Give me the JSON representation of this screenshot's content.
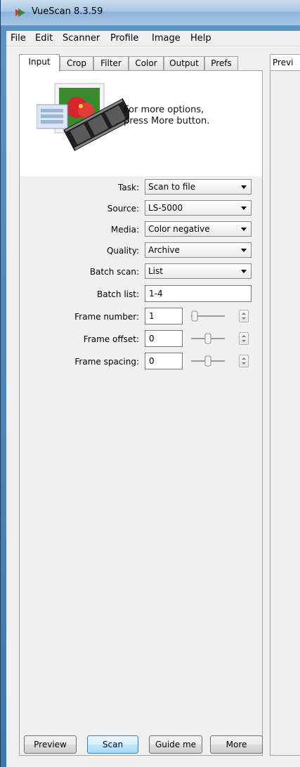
{
  "window": {
    "title": "VueScan 8.3.59"
  },
  "menu": [
    "File",
    "Edit",
    "Scanner",
    "Profile",
    "Image",
    "Help"
  ],
  "tabs": [
    "Input",
    "Crop",
    "Filter",
    "Color",
    "Output",
    "Prefs"
  ],
  "active_tab": "Input",
  "preview_tab": "Previ",
  "hint": {
    "line1": "For more options,",
    "line2": "press More button."
  },
  "fields": {
    "task": {
      "label": "Task:",
      "value": "Scan to file"
    },
    "source": {
      "label": "Source:",
      "value": "LS-5000"
    },
    "media": {
      "label": "Media:",
      "value": "Color negative"
    },
    "quality": {
      "label": "Quality:",
      "value": "Archive"
    },
    "batch_scan": {
      "label": "Batch scan:",
      "value": "List"
    },
    "batch_list": {
      "label": "Batch list:",
      "value": "1-4"
    },
    "frame_number": {
      "label": "Frame number:",
      "value": "1"
    },
    "frame_offset": {
      "label": "Frame offset:",
      "value": "0"
    },
    "frame_spacing": {
      "label": "Frame spacing:",
      "value": "0"
    }
  },
  "buttons": {
    "preview": "Preview",
    "scan": "Scan",
    "guide": "Guide me",
    "more": "More"
  },
  "colors": {
    "title_bar": "#a9c7e6",
    "panel": "#f0f0f0",
    "default_button_border": "#3c7fb1"
  }
}
